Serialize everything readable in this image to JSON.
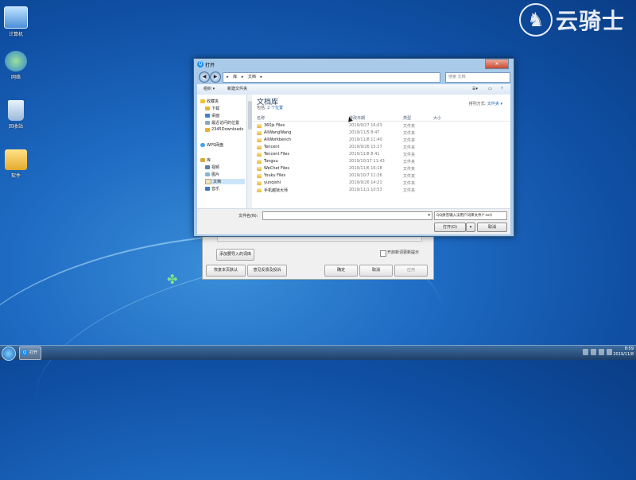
{
  "desktop": {
    "icons": [
      {
        "label": "计算机"
      },
      {
        "label": "网络"
      },
      {
        "label": "回收站"
      },
      {
        "label": "软件"
      }
    ],
    "watermark": "云骑士"
  },
  "settings_dialog": {
    "add_dict_label": "添加要导入的词库",
    "checkbox_label": "开启新词更新提示",
    "btn_restore": "恢复本页默认",
    "btn_feedback": "意见反馈及投诉",
    "btn_ok": "确定",
    "btn_cancel": "取消",
    "btn_apply": "应用"
  },
  "open_dialog": {
    "title": "打开",
    "address": [
      "库",
      "文档"
    ],
    "search_placeholder": "搜索 文档",
    "toolbar": {
      "organize": "组织 ▾",
      "new_folder": "新建文件夹"
    },
    "nav": [
      {
        "label": "收藏夹",
        "icon": "star-icon"
      },
      {
        "label": "下载",
        "icon": "download-icon"
      },
      {
        "label": "桌面",
        "icon": "desktop-icon"
      },
      {
        "label": "最近访问的位置",
        "icon": "recent-icon"
      },
      {
        "label": "2345Downloads",
        "icon": "folder-icon"
      },
      {
        "label": "WPS网盘",
        "icon": "cloud-icon"
      },
      {
        "label": "库",
        "icon": "library-icon"
      },
      {
        "label": "视频",
        "icon": "video-icon"
      },
      {
        "label": "图片",
        "icon": "image-icon"
      },
      {
        "label": "文档",
        "icon": "document-icon"
      },
      {
        "label": "音乐",
        "icon": "music-icon"
      }
    ],
    "library": {
      "title": "文档库",
      "includes": "包括:",
      "locations": "2 个位置",
      "arrange_label": "排列方式:",
      "arrange_value": "文件夹 ▾"
    },
    "columns": [
      "名称",
      "修改日期",
      "类型",
      "大小"
    ],
    "files": [
      {
        "name": "360js Files",
        "date": "2019/9/27 16:03",
        "type": "文件夹"
      },
      {
        "name": "AliWangWang",
        "date": "2019/11/5 8:47",
        "type": "文件夹"
      },
      {
        "name": "AliWorkbench",
        "date": "2019/11/8 11:40",
        "type": "文件夹"
      },
      {
        "name": "Tencent",
        "date": "2019/9/26 15:27",
        "type": "文件夹"
      },
      {
        "name": "Tencent Files",
        "date": "2019/11/8 8:41",
        "type": "文件夹"
      },
      {
        "name": "Tongxu",
        "date": "2019/10/17 11:43",
        "type": "文件夹"
      },
      {
        "name": "WeChat Files",
        "date": "2019/11/6 16:18",
        "type": "文件夹"
      },
      {
        "name": "Youku Files",
        "date": "2019/10/7 11:26",
        "type": "文件夹"
      },
      {
        "name": "yunqishi",
        "date": "2019/9/26 14:21",
        "type": "文件夹"
      },
      {
        "name": "手机越狱大师",
        "date": "2019/11/1 10:53",
        "type": "文件夹"
      }
    ],
    "filename_label": "文件名(N):",
    "filename_value": "",
    "filetype": "QQ拼音输入法用户词库文件(*.txt)",
    "btn_open": "打开(O)",
    "btn_cancel": "取消"
  },
  "taskbar": {
    "app_label": "打开",
    "time": "8:59",
    "date": "2019/11/8"
  }
}
